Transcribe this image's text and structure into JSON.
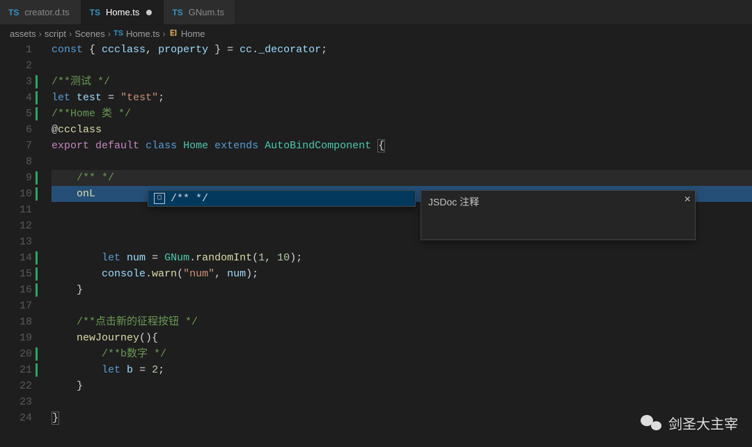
{
  "tabs": [
    {
      "icon": "TS",
      "label": "creator.d.ts",
      "active": false,
      "dirty": false
    },
    {
      "icon": "TS",
      "label": "Home.ts",
      "active": true,
      "dirty": true
    },
    {
      "icon": "TS",
      "label": "GNum.ts",
      "active": false,
      "dirty": false
    }
  ],
  "breadcrumb": {
    "parts": [
      "assets",
      "script",
      "Scenes"
    ],
    "file_icon": "TS",
    "file": "Home.ts",
    "symbol_icon": "class",
    "symbol": "Home",
    "sep": "›"
  },
  "gutter": {
    "numbers": [
      "1",
      "2",
      "3",
      "4",
      "5",
      "6",
      "7",
      "8",
      "9",
      "10",
      "11",
      "12",
      "13",
      "14",
      "15",
      "16",
      "17",
      "18",
      "19",
      "20",
      "21",
      "22",
      "23",
      "24"
    ],
    "modified": [
      3,
      4,
      5,
      9,
      10,
      14,
      15,
      16,
      20,
      21
    ]
  },
  "code": {
    "l1": {
      "a": "const",
      "b": " { ",
      "c": "ccclass",
      "d": ", ",
      "e": "property",
      "f": " } = ",
      "g": "cc",
      "h": ".",
      "i": "_decorator",
      "j": ";"
    },
    "l3": "/**测试 */",
    "l4": {
      "a": "let",
      "b": " ",
      "c": "test",
      "d": " = ",
      "e": "\"test\"",
      "f": ";"
    },
    "l5": "/**Home 类 */",
    "l6": {
      "a": "@",
      "b": "ccclass"
    },
    "l7": {
      "a": "export",
      "b": " ",
      "c": "default",
      "d": " ",
      "e": "class",
      "f": " ",
      "g": "Home",
      "h": " ",
      "i": "extends",
      "j": " ",
      "k": "AutoBindComponent",
      "l": " ",
      "m": "{"
    },
    "l9": "/** */",
    "l10": {
      "a": "onL",
      "b": "  /** */"
    },
    "l14": {
      "a": "let",
      "b": " ",
      "c": "num",
      "d": " = ",
      "e": "GNum",
      "f": ".",
      "g": "randomInt",
      "h": "(",
      "i": "1",
      "j": ", ",
      "k": "10",
      "l": ");"
    },
    "l15": {
      "a": "console",
      "b": ".",
      "c": "warn",
      "d": "(",
      "e": "\"num\"",
      "f": ", ",
      "g": "num",
      "h": ");"
    },
    "l16": "}",
    "l18": "/**点击新的征程按钮 */",
    "l19": {
      "a": "newJourney",
      "b": "(){"
    },
    "l20": "/**b数字 */",
    "l21": {
      "a": "let",
      "b": " ",
      "c": "b",
      "d": " = ",
      "e": "2",
      "f": ";"
    },
    "l22": "}",
    "l24": "}"
  },
  "suggest": {
    "item": "/** */"
  },
  "doc": {
    "title": "JSDoc 注释",
    "close": "×"
  },
  "watermark": "剑圣大主宰"
}
